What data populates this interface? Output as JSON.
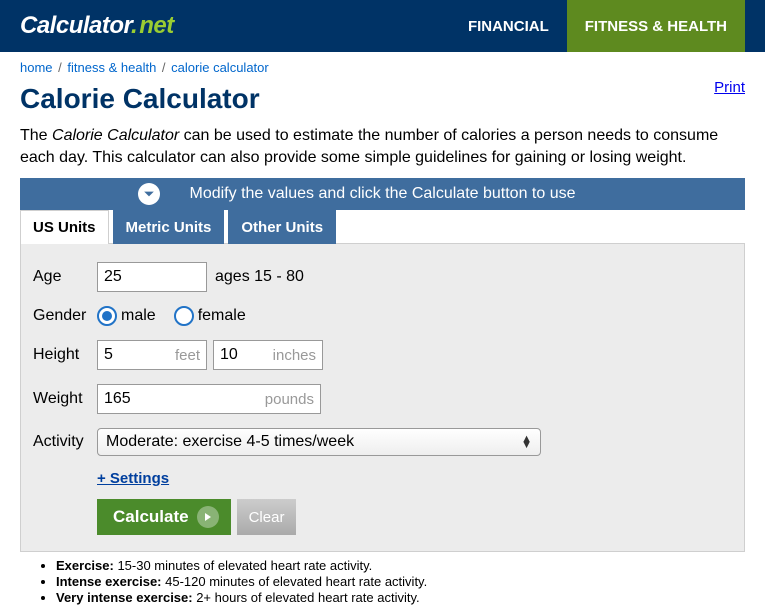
{
  "header": {
    "logo_main": "Calculator",
    "logo_dot": ".",
    "logo_net": "net",
    "nav": [
      {
        "label": "FINANCIAL",
        "active": false
      },
      {
        "label": "FITNESS & HEALTH",
        "active": true
      }
    ]
  },
  "breadcrumb": {
    "home": "home",
    "fitness": "fitness & health",
    "current": "calorie calculator"
  },
  "print_label": "Print",
  "title": "Calorie Calculator",
  "intro_em": "Calorie Calculator",
  "intro_before": "The ",
  "intro_after": " can be used to estimate the number of calories a person needs to consume each day. This calculator can also provide some simple guidelines for gaining or losing weight.",
  "banner": "Modify the values and click the Calculate button to use",
  "tabs": [
    {
      "label": "US Units"
    },
    {
      "label": "Metric Units"
    },
    {
      "label": "Other Units"
    }
  ],
  "form": {
    "age_label": "Age",
    "age_value": "25",
    "age_hint": "ages 15 - 80",
    "gender_label": "Gender",
    "gender_male": "male",
    "gender_female": "female",
    "height_label": "Height",
    "height_feet_value": "5",
    "height_feet_unit": "feet",
    "height_in_value": "10",
    "height_in_unit": "inches",
    "weight_label": "Weight",
    "weight_value": "165",
    "weight_unit": "pounds",
    "activity_label": "Activity",
    "activity_value": "Moderate: exercise 4-5 times/week",
    "settings_link": "+ Settings",
    "calculate": "Calculate",
    "clear": "Clear"
  },
  "notes": [
    {
      "b": "Exercise:",
      "t": " 15-30 minutes of elevated heart rate activity."
    },
    {
      "b": "Intense exercise:",
      "t": " 45-120 minutes of elevated heart rate activity."
    },
    {
      "b": "Very intense exercise:",
      "t": " 2+ hours of elevated heart rate activity."
    }
  ]
}
